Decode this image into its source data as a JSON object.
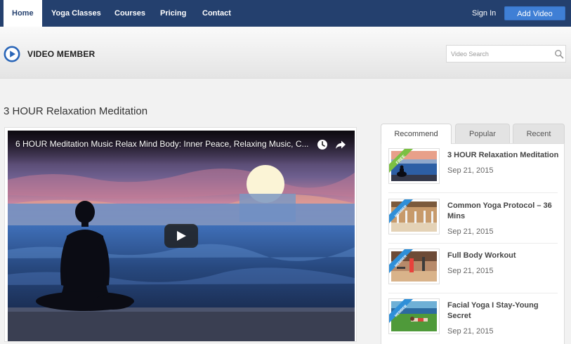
{
  "nav": {
    "items": [
      {
        "label": "Home",
        "active": true
      },
      {
        "label": "Yoga Classes",
        "active": false
      },
      {
        "label": "Courses",
        "active": false
      },
      {
        "label": "Pricing",
        "active": false
      },
      {
        "label": "Contact",
        "active": false
      }
    ],
    "signin_label": "Sign In",
    "add_video_label": "Add Video"
  },
  "header": {
    "logo_text": "VIDEO MEMBER",
    "search_placeholder": "Video Search",
    "search_icon": "search-icon"
  },
  "main": {
    "page_title": "3 HOUR Relaxation Meditation",
    "video": {
      "title": "6 HOUR Meditation Music Relax Mind Body: Inner Peace, Relaxing Music, C...",
      "icons": [
        "clock-icon",
        "share-icon",
        "play-icon"
      ]
    }
  },
  "sidebar": {
    "tabs": [
      {
        "label": "Recommend",
        "active": true
      },
      {
        "label": "Popular",
        "active": false
      },
      {
        "label": "Recent",
        "active": false
      }
    ],
    "items": [
      {
        "title": "3 HOUR Relaxation Meditation",
        "date": "Sep 21, 2015",
        "badge": "FREE"
      },
      {
        "title": "Common Yoga Protocol – 36 Mins",
        "date": "Sep 21, 2015",
        "badge": "MEMBER"
      },
      {
        "title": "Full Body Workout",
        "date": "Sep 21, 2015",
        "badge": "MEMBER"
      },
      {
        "title": "Facial Yoga I Stay-Young Secret",
        "date": "Sep 21, 2015",
        "badge": "MEMBER"
      }
    ]
  },
  "colors": {
    "nav_bg": "#24406e",
    "accent_button": "#3f7fd5",
    "logo_blue": "#2a66b8",
    "badge_free": "#7bc043",
    "badge_member": "#2f8fd8"
  }
}
